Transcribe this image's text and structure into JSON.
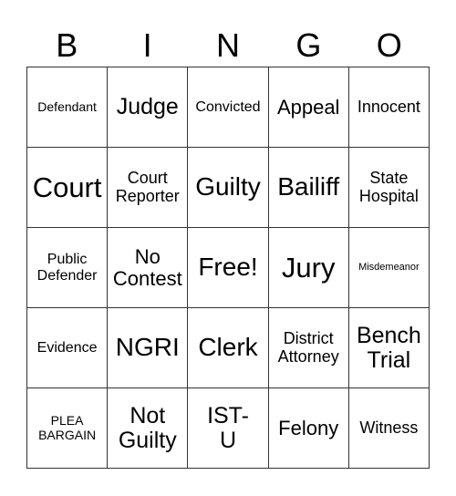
{
  "header": {
    "letters": [
      "B",
      "I",
      "N",
      "G",
      "O"
    ]
  },
  "board": {
    "rows": [
      [
        "Defendant",
        "Judge",
        "Convicted",
        "Appeal",
        "Innocent"
      ],
      [
        "Court",
        "Court\nReporter",
        "Guilty",
        "Bailiff",
        "State\nHospital"
      ],
      [
        "Public\nDefender",
        "No\nContest",
        "Free!",
        "Jury",
        "Misdemeanor"
      ],
      [
        "Evidence",
        "NGRI",
        "Clerk",
        "District\nAttorney",
        "Bench\nTrial"
      ],
      [
        "PLEA\nBARGAIN",
        "Not\nGuilty",
        "IST-\nU",
        "Felony",
        "Witness"
      ]
    ],
    "free_space": "Free!"
  },
  "colors": {
    "background": "#ffffff",
    "grid_line": "#333333",
    "text": "#000000"
  }
}
